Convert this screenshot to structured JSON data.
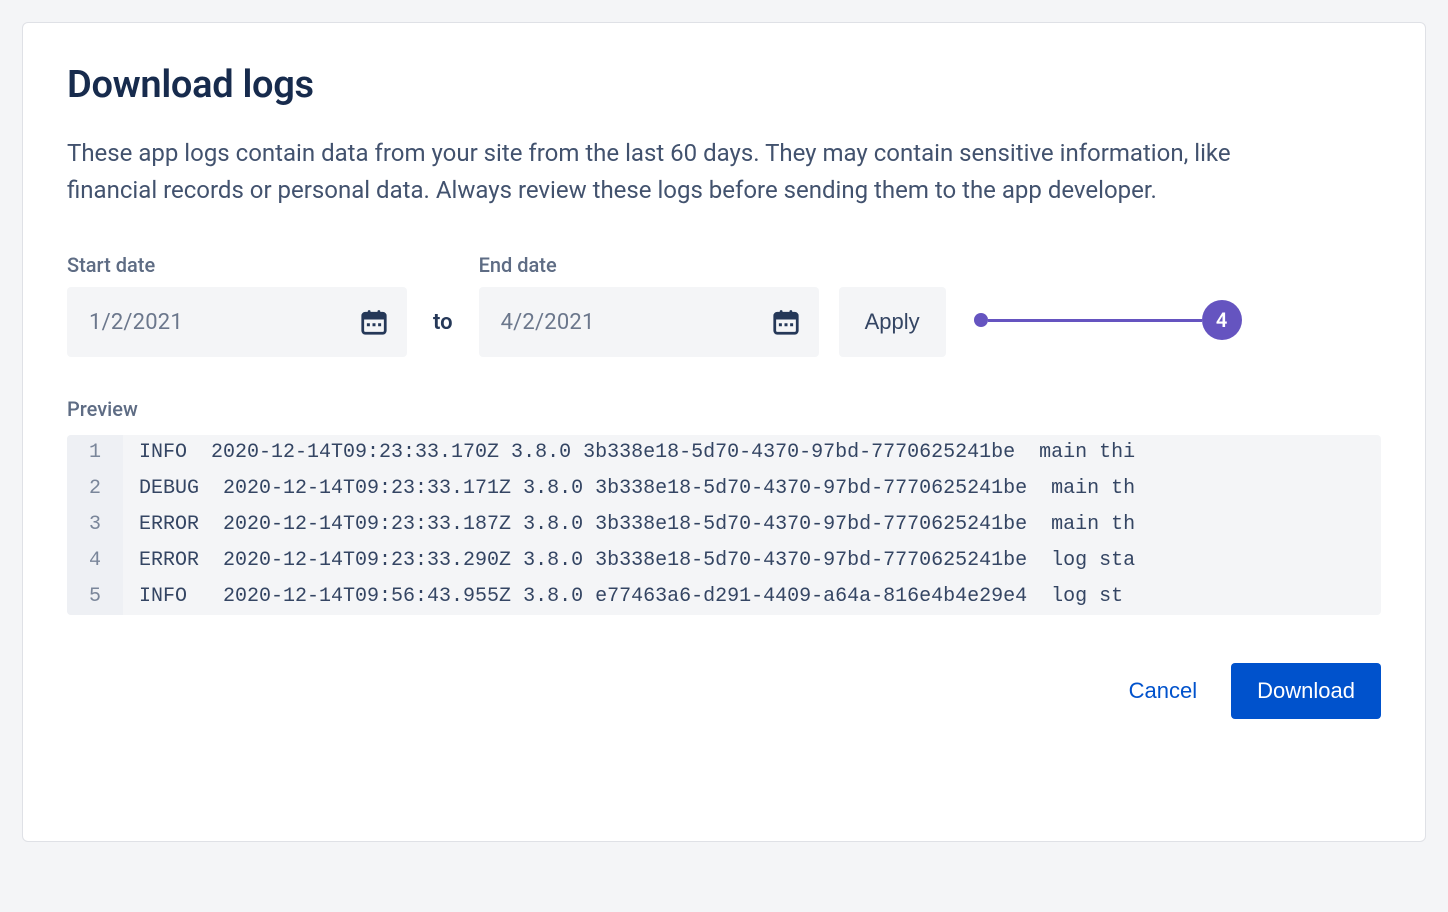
{
  "title": "Download logs",
  "description": "These app logs contain data from your site from the last 60 days. They may contain sensitive information, like financial records or personal data. Always review these logs before sending them to the app developer.",
  "dates": {
    "start_label": "Start date",
    "start_value": "1/2/2021",
    "to_label": "to",
    "end_label": "End date",
    "end_value": "4/2/2021",
    "apply_label": "Apply"
  },
  "callout": {
    "number": "4"
  },
  "preview": {
    "label": "Preview",
    "lines": [
      "INFO  2020-12-14T09:23:33.170Z 3.8.0 3b338e18-5d70-4370-97bd-7770625241be  main thi",
      "DEBUG  2020-12-14T09:23:33.171Z 3.8.0 3b338e18-5d70-4370-97bd-7770625241be  main th",
      "ERROR  2020-12-14T09:23:33.187Z 3.8.0 3b338e18-5d70-4370-97bd-7770625241be  main th",
      "ERROR  2020-12-14T09:23:33.290Z 3.8.0 3b338e18-5d70-4370-97bd-7770625241be  log sta",
      "INFO   2020-12-14T09:56:43.955Z 3.8.0 e77463a6-d291-4409-a64a-816e4b4e29e4  log st"
    ]
  },
  "actions": {
    "cancel": "Cancel",
    "download": "Download"
  }
}
